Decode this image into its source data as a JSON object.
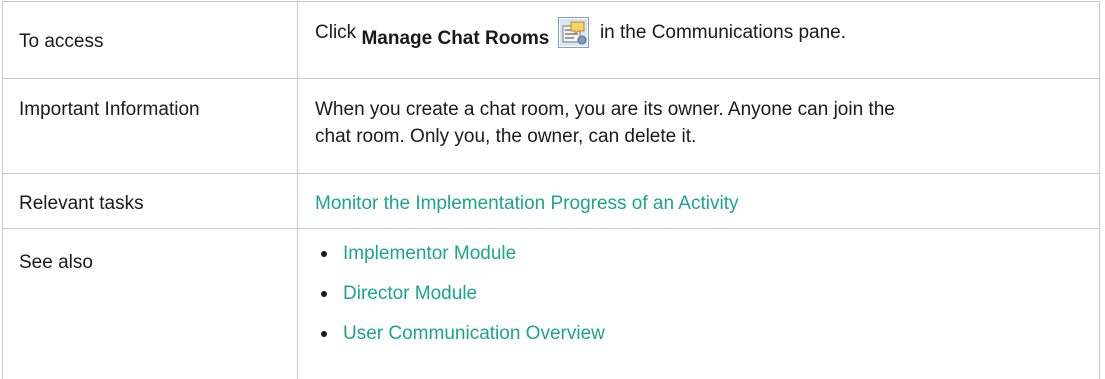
{
  "rows": {
    "access": {
      "label": "To access",
      "prefix": "Click",
      "ui_element": "Manage Chat Rooms",
      "icon": "manage-chat-rooms-icon",
      "suffix": "in the Communications pane."
    },
    "important": {
      "label": "Important Information",
      "line1": "When you create a chat room, you are its owner. Anyone can join the",
      "line2": "chat room. Only you, the owner, can delete it."
    },
    "tasks": {
      "label": "Relevant tasks",
      "link": "Monitor the Implementation Progress of an Activity"
    },
    "see_also": {
      "label": "See also",
      "links": [
        "Implementor Module",
        "Director Module",
        "User Communication Overview"
      ]
    }
  },
  "colors": {
    "link": "#1aa58c",
    "border": "#c8c8c8",
    "text": "#1a1a1a"
  }
}
